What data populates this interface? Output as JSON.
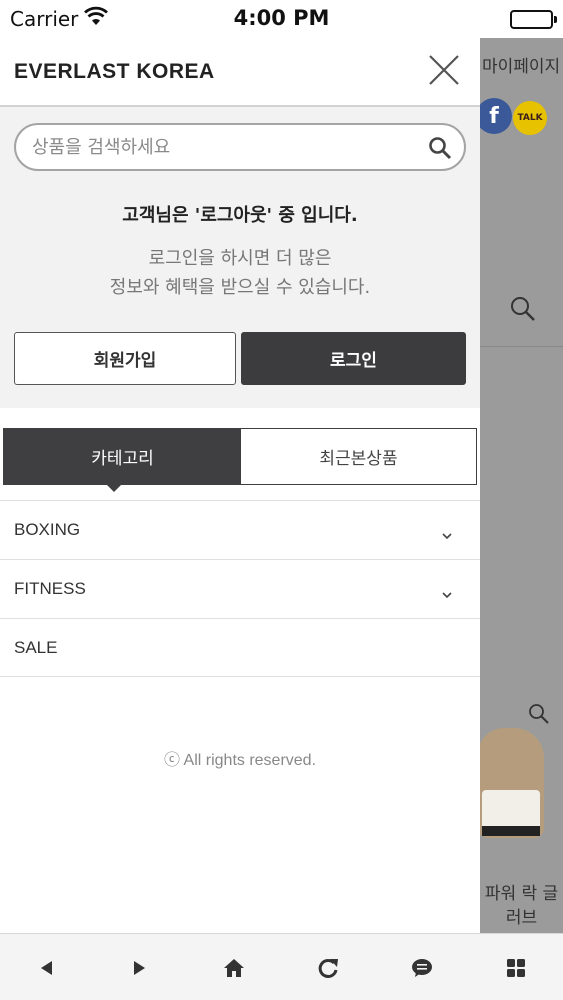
{
  "status_bar": {
    "carrier": "Carrier",
    "time": "4:00 PM"
  },
  "background_page": {
    "mypage_link": "마이페이지",
    "product_name": "파워 락 글러브"
  },
  "drawer": {
    "brand": "EVERLAST KOREA",
    "search": {
      "placeholder": "상품을 검색하세요",
      "value": ""
    },
    "login_status": "고객님은 '로그아웃' 중 입니다.",
    "login_prompt_line1": "로그인을 하시면 더 많은",
    "login_prompt_line2": "정보와 혜택을 받으실 수 있습니다.",
    "join_label": "회원가입",
    "login_label": "로그인",
    "tabs": [
      {
        "label": "카테고리",
        "active": true
      },
      {
        "label": "최근본상품",
        "active": false
      }
    ],
    "menu": [
      {
        "label": "BOXING",
        "expandable": true
      },
      {
        "label": "FITNESS",
        "expandable": true
      },
      {
        "label": "SALE",
        "expandable": false
      }
    ],
    "copyright": "ⓒ All rights reserved."
  },
  "toolbar": [
    "back-icon",
    "forward-icon",
    "home-icon",
    "refresh-icon",
    "chat-icon",
    "grid-icon"
  ],
  "colors": {
    "dark": "#3f3e40",
    "panel": "#f2f2f2",
    "overlay": "#9b9b9b"
  }
}
